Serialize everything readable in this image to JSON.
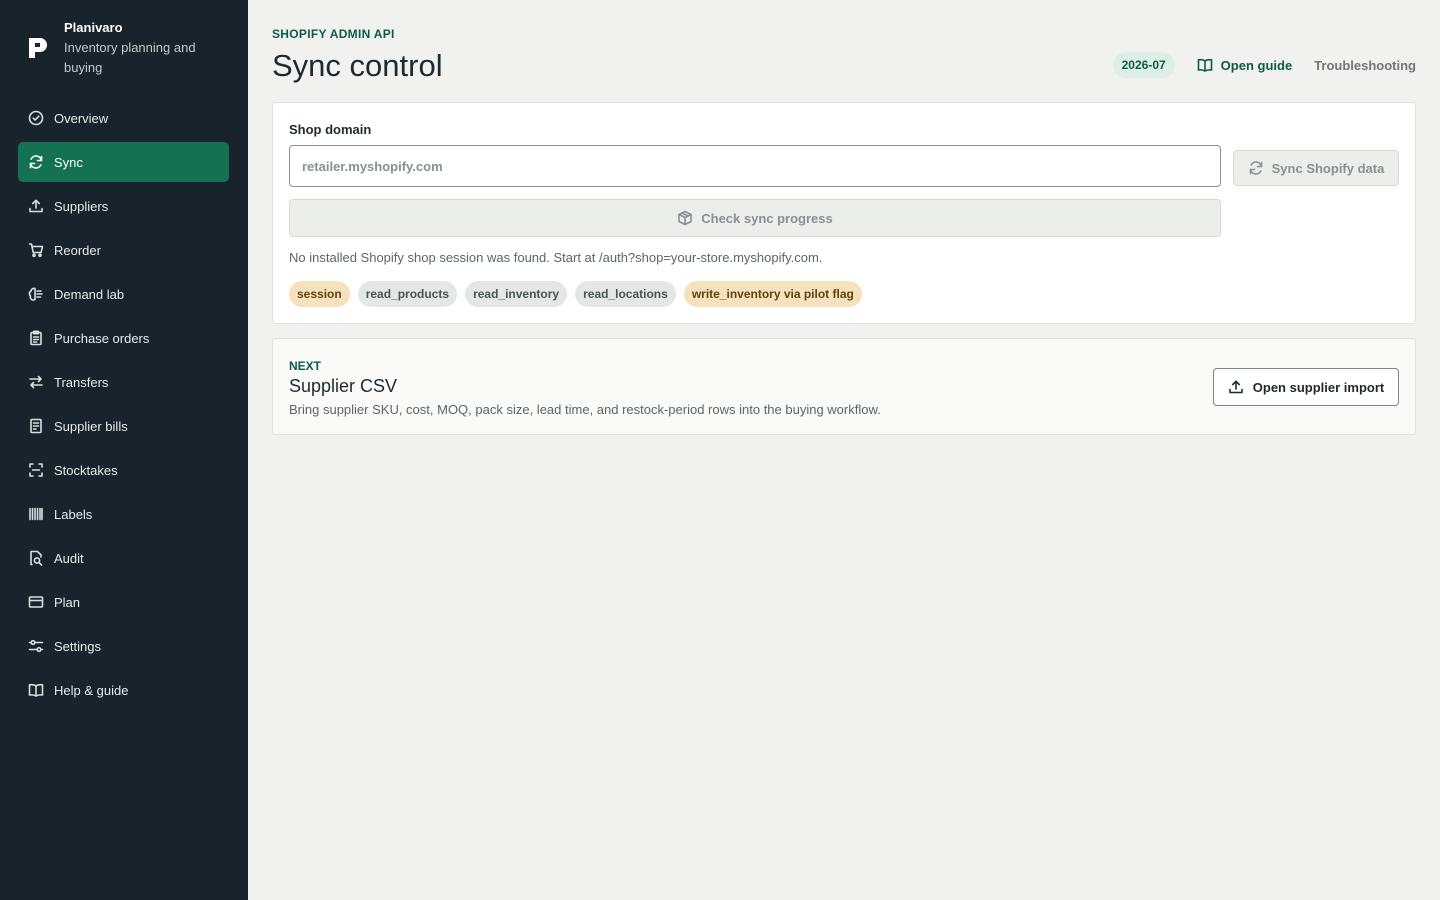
{
  "brand": {
    "name": "Planivaro",
    "tagline": "Inventory planning and buying"
  },
  "sidebar": {
    "items": [
      {
        "label": "Overview",
        "icon": "check-circle-icon",
        "active": false
      },
      {
        "label": "Sync",
        "icon": "refresh-icon",
        "active": true
      },
      {
        "label": "Suppliers",
        "icon": "upload-icon",
        "active": false
      },
      {
        "label": "Reorder",
        "icon": "cart-icon",
        "active": false
      },
      {
        "label": "Demand lab",
        "icon": "brain-icon",
        "active": false
      },
      {
        "label": "Purchase orders",
        "icon": "clipboard-icon",
        "active": false
      },
      {
        "label": "Transfers",
        "icon": "arrows-swap-icon",
        "active": false
      },
      {
        "label": "Supplier bills",
        "icon": "receipt-icon",
        "active": false
      },
      {
        "label": "Stocktakes",
        "icon": "scan-icon",
        "active": false
      },
      {
        "label": "Labels",
        "icon": "barcode-icon",
        "active": false
      },
      {
        "label": "Audit",
        "icon": "file-search-icon",
        "active": false
      },
      {
        "label": "Plan",
        "icon": "credit-card-icon",
        "active": false
      },
      {
        "label": "Settings",
        "icon": "sliders-icon",
        "active": false
      },
      {
        "label": "Help & guide",
        "icon": "book-icon",
        "active": false
      }
    ]
  },
  "header": {
    "eyebrow": "SHOPIFY ADMIN API",
    "title": "Sync control",
    "version": "2026-07",
    "guide_label": "Open guide",
    "troubleshooting_label": "Troubleshooting"
  },
  "sync_card": {
    "field_label": "Shop domain",
    "input_value": "",
    "input_placeholder": "retailer.myshopify.com",
    "sync_button": "Sync Shopify data",
    "progress_button": "Check sync progress",
    "status": "No installed Shopify shop session was found. Start at /auth?shop=your-store.myshopify.com.",
    "chips": [
      {
        "label": "session",
        "tone": "warn"
      },
      {
        "label": "read_products",
        "tone": "neutral"
      },
      {
        "label": "read_inventory",
        "tone": "neutral"
      },
      {
        "label": "read_locations",
        "tone": "neutral"
      },
      {
        "label": "write_inventory via pilot flag",
        "tone": "warn"
      }
    ]
  },
  "next_card": {
    "eyebrow": "NEXT",
    "title": "Supplier CSV",
    "description": "Bring supplier SKU, cost, MOQ, pack size, lead time, and restock-period rows into the buying workflow.",
    "button": "Open supplier import"
  },
  "colors": {
    "sidebar_bg": "#18232b",
    "accent": "#147252",
    "accent_text": "#0f5a46",
    "page_bg": "#f1f1f0"
  }
}
